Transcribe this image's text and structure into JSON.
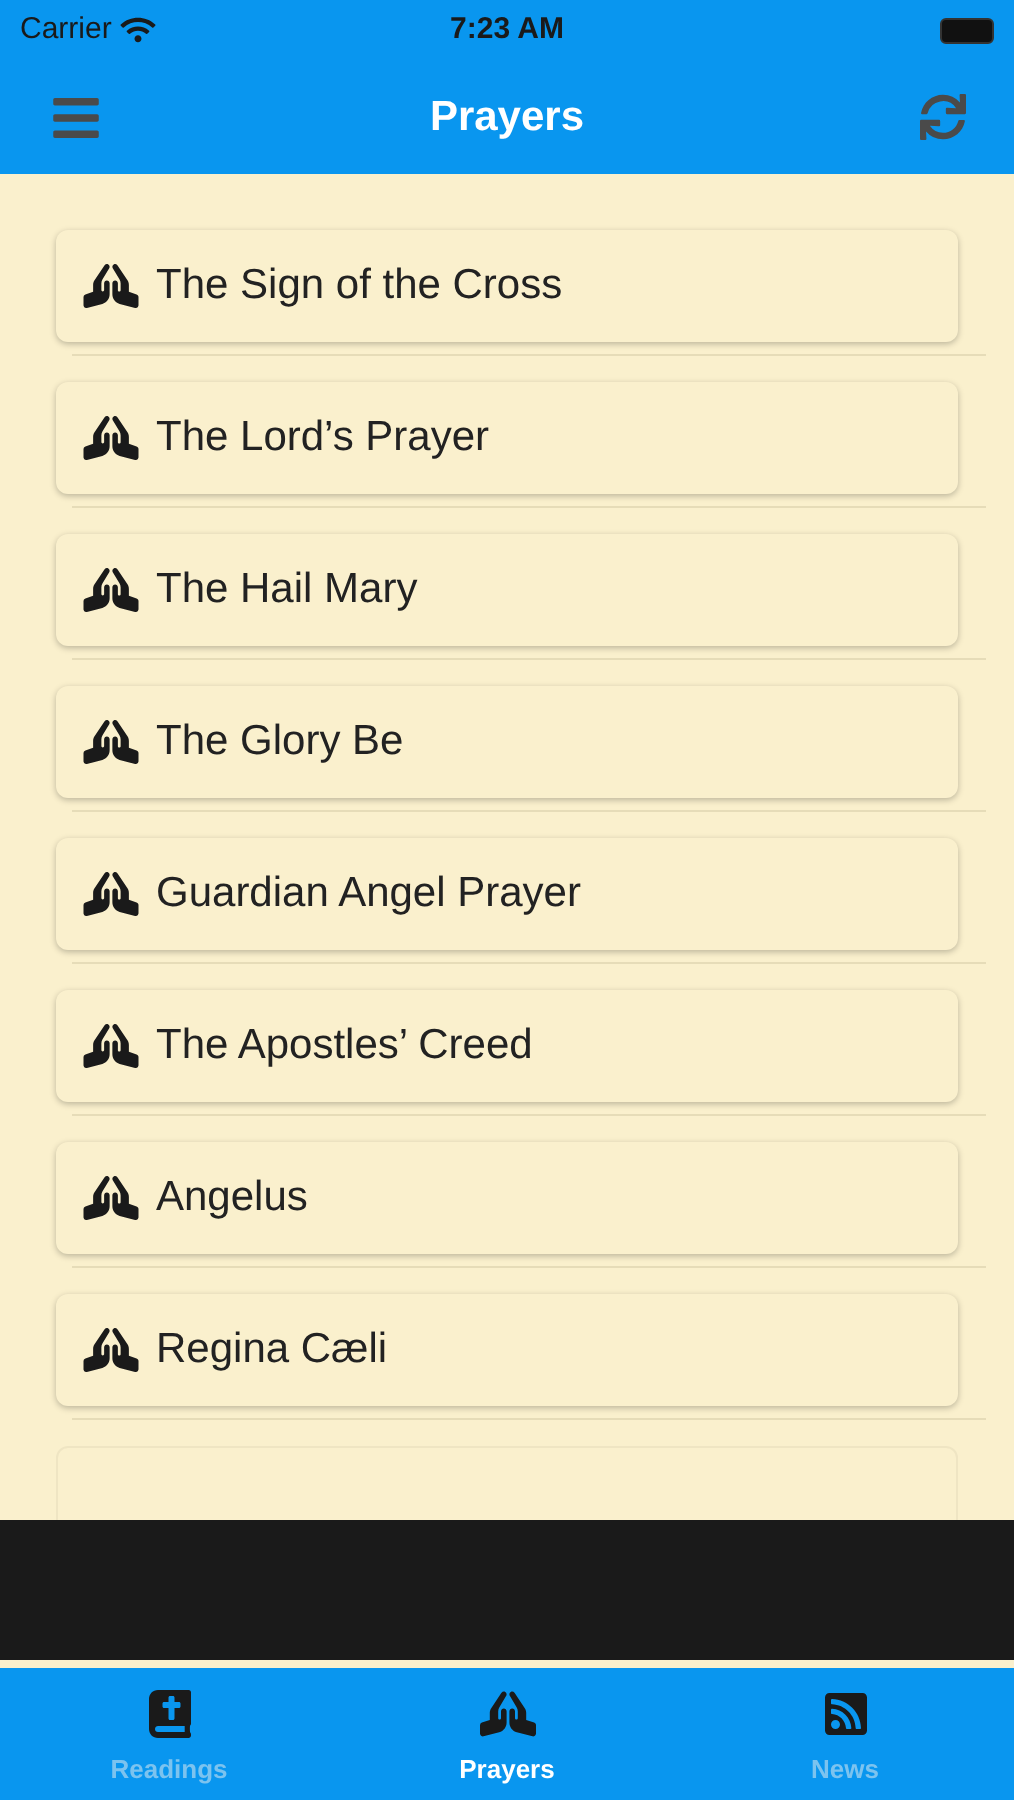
{
  "status_bar": {
    "carrier": "Carrier",
    "time": "7:23 AM"
  },
  "header": {
    "title": "Prayers"
  },
  "prayers": [
    {
      "title": "The Sign of the Cross"
    },
    {
      "title": "The Lord’s Prayer"
    },
    {
      "title": "The Hail Mary"
    },
    {
      "title": "The Glory Be"
    },
    {
      "title": "Guardian Angel Prayer"
    },
    {
      "title": "The Apostles’ Creed"
    },
    {
      "title": "Angelus"
    },
    {
      "title": "Regina Cæli"
    }
  ],
  "tabs": [
    {
      "label": "Readings",
      "kind": "bible",
      "selected": false
    },
    {
      "label": "Prayers",
      "kind": "pray",
      "selected": true
    },
    {
      "label": "News",
      "kind": "rss",
      "selected": false
    }
  ]
}
